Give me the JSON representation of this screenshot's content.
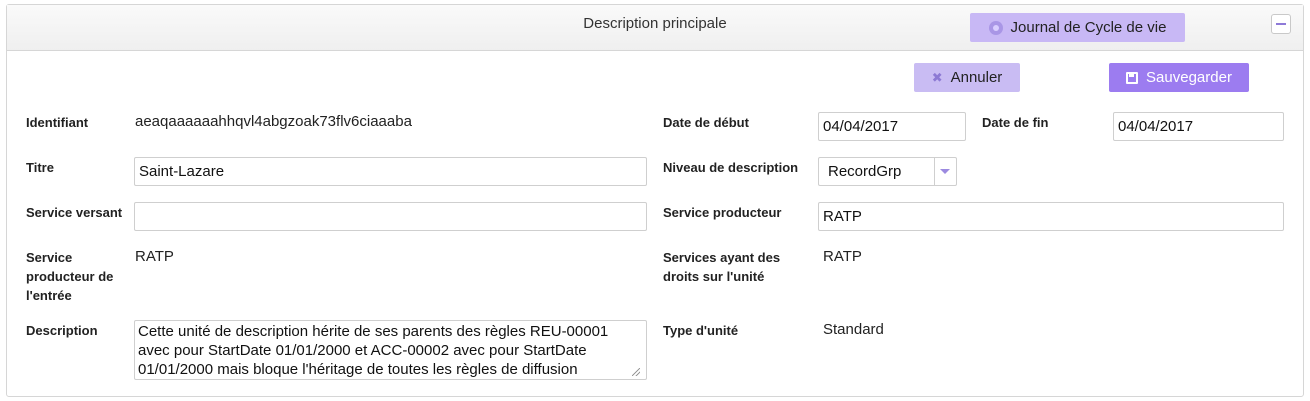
{
  "panel": {
    "title": "Description principale",
    "journal_button": "Journal de Cycle de vie"
  },
  "actions": {
    "cancel": "Annuler",
    "save": "Sauvegarder"
  },
  "fields": {
    "identifiant": {
      "label": "Identifiant",
      "value": "aeaqaaaaaahhqvl4abgzoak73flv6ciaaaba"
    },
    "titre": {
      "label": "Titre",
      "value": "Saint-Lazare"
    },
    "service_versant": {
      "label": "Service versant",
      "value": ""
    },
    "service_producteur_entree": {
      "label_lines": [
        "Service",
        "producteur de",
        "l'entrée"
      ],
      "value": "RATP"
    },
    "description": {
      "label": "Description",
      "value": "Cette unité de description hérite de ses parents des règles REU-00001 avec pour StartDate 01/01/2000 et ACC-00002 avec pour StartDate 01/01/2000 mais bloque l'héritage de toutes les règles de diffusion"
    },
    "date_debut": {
      "label": "Date de début",
      "value": "04/04/2017"
    },
    "date_fin": {
      "label": "Date de fin",
      "value": "04/04/2017"
    },
    "niveau_description": {
      "label": "Niveau de description",
      "value": "RecordGrp"
    },
    "service_producteur": {
      "label": "Service producteur",
      "value": "RATP"
    },
    "services_droits": {
      "label_lines": [
        "Services ayant des",
        "droits sur l'unité"
      ],
      "value": "RATP"
    },
    "type_unite": {
      "label": "Type d'unité",
      "value": "Standard"
    }
  },
  "colors": {
    "accent": "#9c7cf0",
    "accent_light": "#c8b8f5"
  },
  "icons": {
    "journal": "chrome-icon",
    "collapse": "minus-icon",
    "cancel": "close-icon",
    "save": "floppy-disk-icon",
    "select": "caret-down-icon"
  }
}
